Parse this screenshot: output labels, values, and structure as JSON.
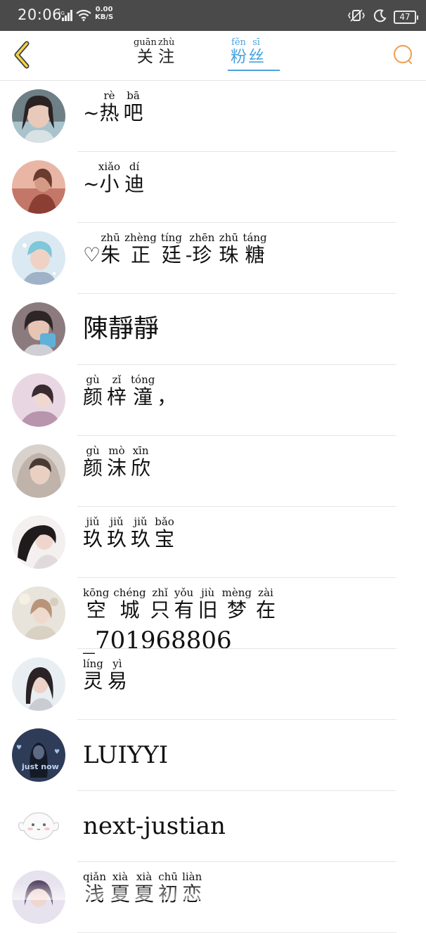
{
  "status_bar": {
    "time": "20:06",
    "network": "4G",
    "speed_value": "0.00",
    "speed_unit": "KB/S",
    "battery": "47"
  },
  "header": {
    "back_icon": "chevron-left-icon",
    "tabs": [
      {
        "label": "关注",
        "pinyin": [
          "guān",
          "zhù"
        ],
        "chars": [
          "关",
          "注"
        ],
        "active": false
      },
      {
        "label": "粉丝",
        "pinyin": [
          "fěn",
          "sī"
        ],
        "chars": [
          "粉",
          "丝"
        ],
        "active": true
      }
    ],
    "search_icon": "search-icon",
    "accent_color": "#4aa3df",
    "icon_color": "#f0a35a"
  },
  "fans": [
    {
      "display": "~热吧",
      "prefix": "~",
      "chars": [
        "热",
        "吧"
      ],
      "pinyin": [
        "rè",
        "bā"
      ]
    },
    {
      "display": "~小迪",
      "prefix": "~",
      "chars": [
        "小",
        "迪"
      ],
      "pinyin": [
        "xiǎo",
        "dí"
      ]
    },
    {
      "display": "♡朱正廷-珍珠糖",
      "prefix": "♡",
      "chars": [
        "朱",
        "正",
        "廷",
        "-",
        "珍",
        "珠",
        "糖"
      ],
      "pinyin": [
        "zhū",
        "zhèng",
        "tíng",
        "",
        "zhēn",
        "zhū",
        "táng"
      ]
    },
    {
      "display": "陳靜靜",
      "plain": "陳靜靜"
    },
    {
      "display": "颜梓潼，",
      "chars": [
        "颜",
        "梓",
        "潼",
        "，"
      ],
      "pinyin": [
        "gù",
        "zǐ",
        "tóng",
        ""
      ]
    },
    {
      "display": "颜沫欣",
      "chars": [
        "颜",
        "沫",
        "欣"
      ],
      "pinyin": [
        "gù",
        "mò",
        "xīn"
      ]
    },
    {
      "display": "玖玖玖宝",
      "chars": [
        "玖",
        "玖",
        "玖",
        "宝"
      ],
      "pinyin": [
        "jiǔ",
        "jiǔ",
        "jiǔ",
        "bǎo"
      ]
    },
    {
      "display": "空城只有旧梦在_701968806",
      "chars": [
        "空",
        "城",
        "只",
        "有",
        "旧",
        "梦",
        "在"
      ],
      "pinyin": [
        "kōng",
        "chéng",
        "zhǐ",
        "yǒu",
        "jiù",
        "mèng",
        "zài"
      ],
      "tail": "_701968806"
    },
    {
      "display": "灵易",
      "chars": [
        "灵",
        "易"
      ],
      "pinyin": [
        "líng",
        "yì"
      ]
    },
    {
      "display": "LUIYYI",
      "latin": "LUIYYI"
    },
    {
      "display": "next-justian",
      "latin": "next-justian"
    },
    {
      "display": "浅夏夏初恋",
      "chars": [
        "浅",
        "夏",
        "夏",
        "初",
        "恋"
      ],
      "pinyin": [
        "qiǎn",
        "xià",
        "xià",
        "chū",
        "liàn"
      ]
    }
  ],
  "avatar_overlay_text": "just now"
}
